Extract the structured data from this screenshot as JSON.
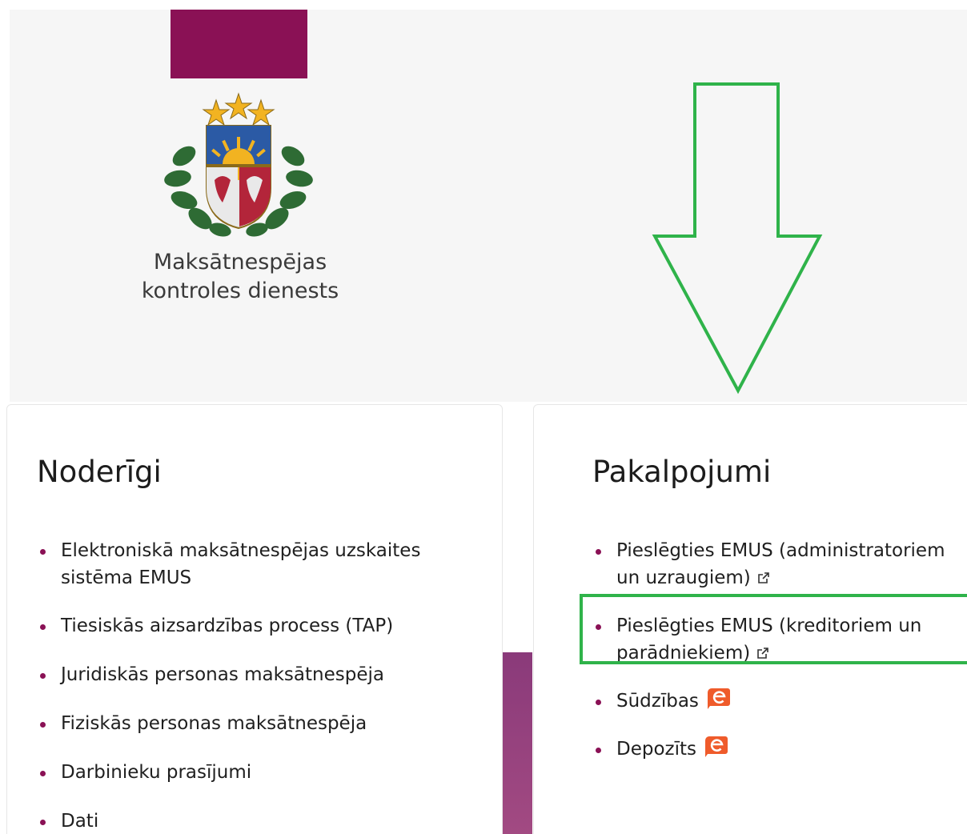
{
  "header": {
    "org_name_line1": "Maksātnespējas",
    "org_name_line2": "kontroles dienests",
    "colors": {
      "brand": "#8a1155",
      "header_bg": "#f6f6f6",
      "annotation": "#2fb34a"
    }
  },
  "noderigi": {
    "title": "Noderīgi",
    "items": [
      {
        "label": "Elektroniskā maksātnespējas uzskaites sistēma EMUS"
      },
      {
        "label": "Tiesiskās aizsardzības process (TAP)"
      },
      {
        "label": "Juridiskās personas maksātnespēja"
      },
      {
        "label": "Fiziskās personas maksātnespēja"
      },
      {
        "label": "Darbinieku prasījumi"
      },
      {
        "label": "Dati"
      }
    ]
  },
  "pakalpojumi": {
    "title": "Pakalpojumi",
    "items": [
      {
        "label_line1": "Pieslēgties EMUS (administratoriem",
        "label_line2": "un uzraugiem)",
        "icon": "external-link-icon"
      },
      {
        "label_line1": "Pieslēgties EMUS (kreditoriem un",
        "label_line2": "parādniekiem)",
        "icon": "external-link-icon"
      },
      {
        "label": "Sūdzības",
        "icon": "e-service-icon"
      },
      {
        "label": "Depozīts",
        "icon": "e-service-icon"
      }
    ]
  }
}
